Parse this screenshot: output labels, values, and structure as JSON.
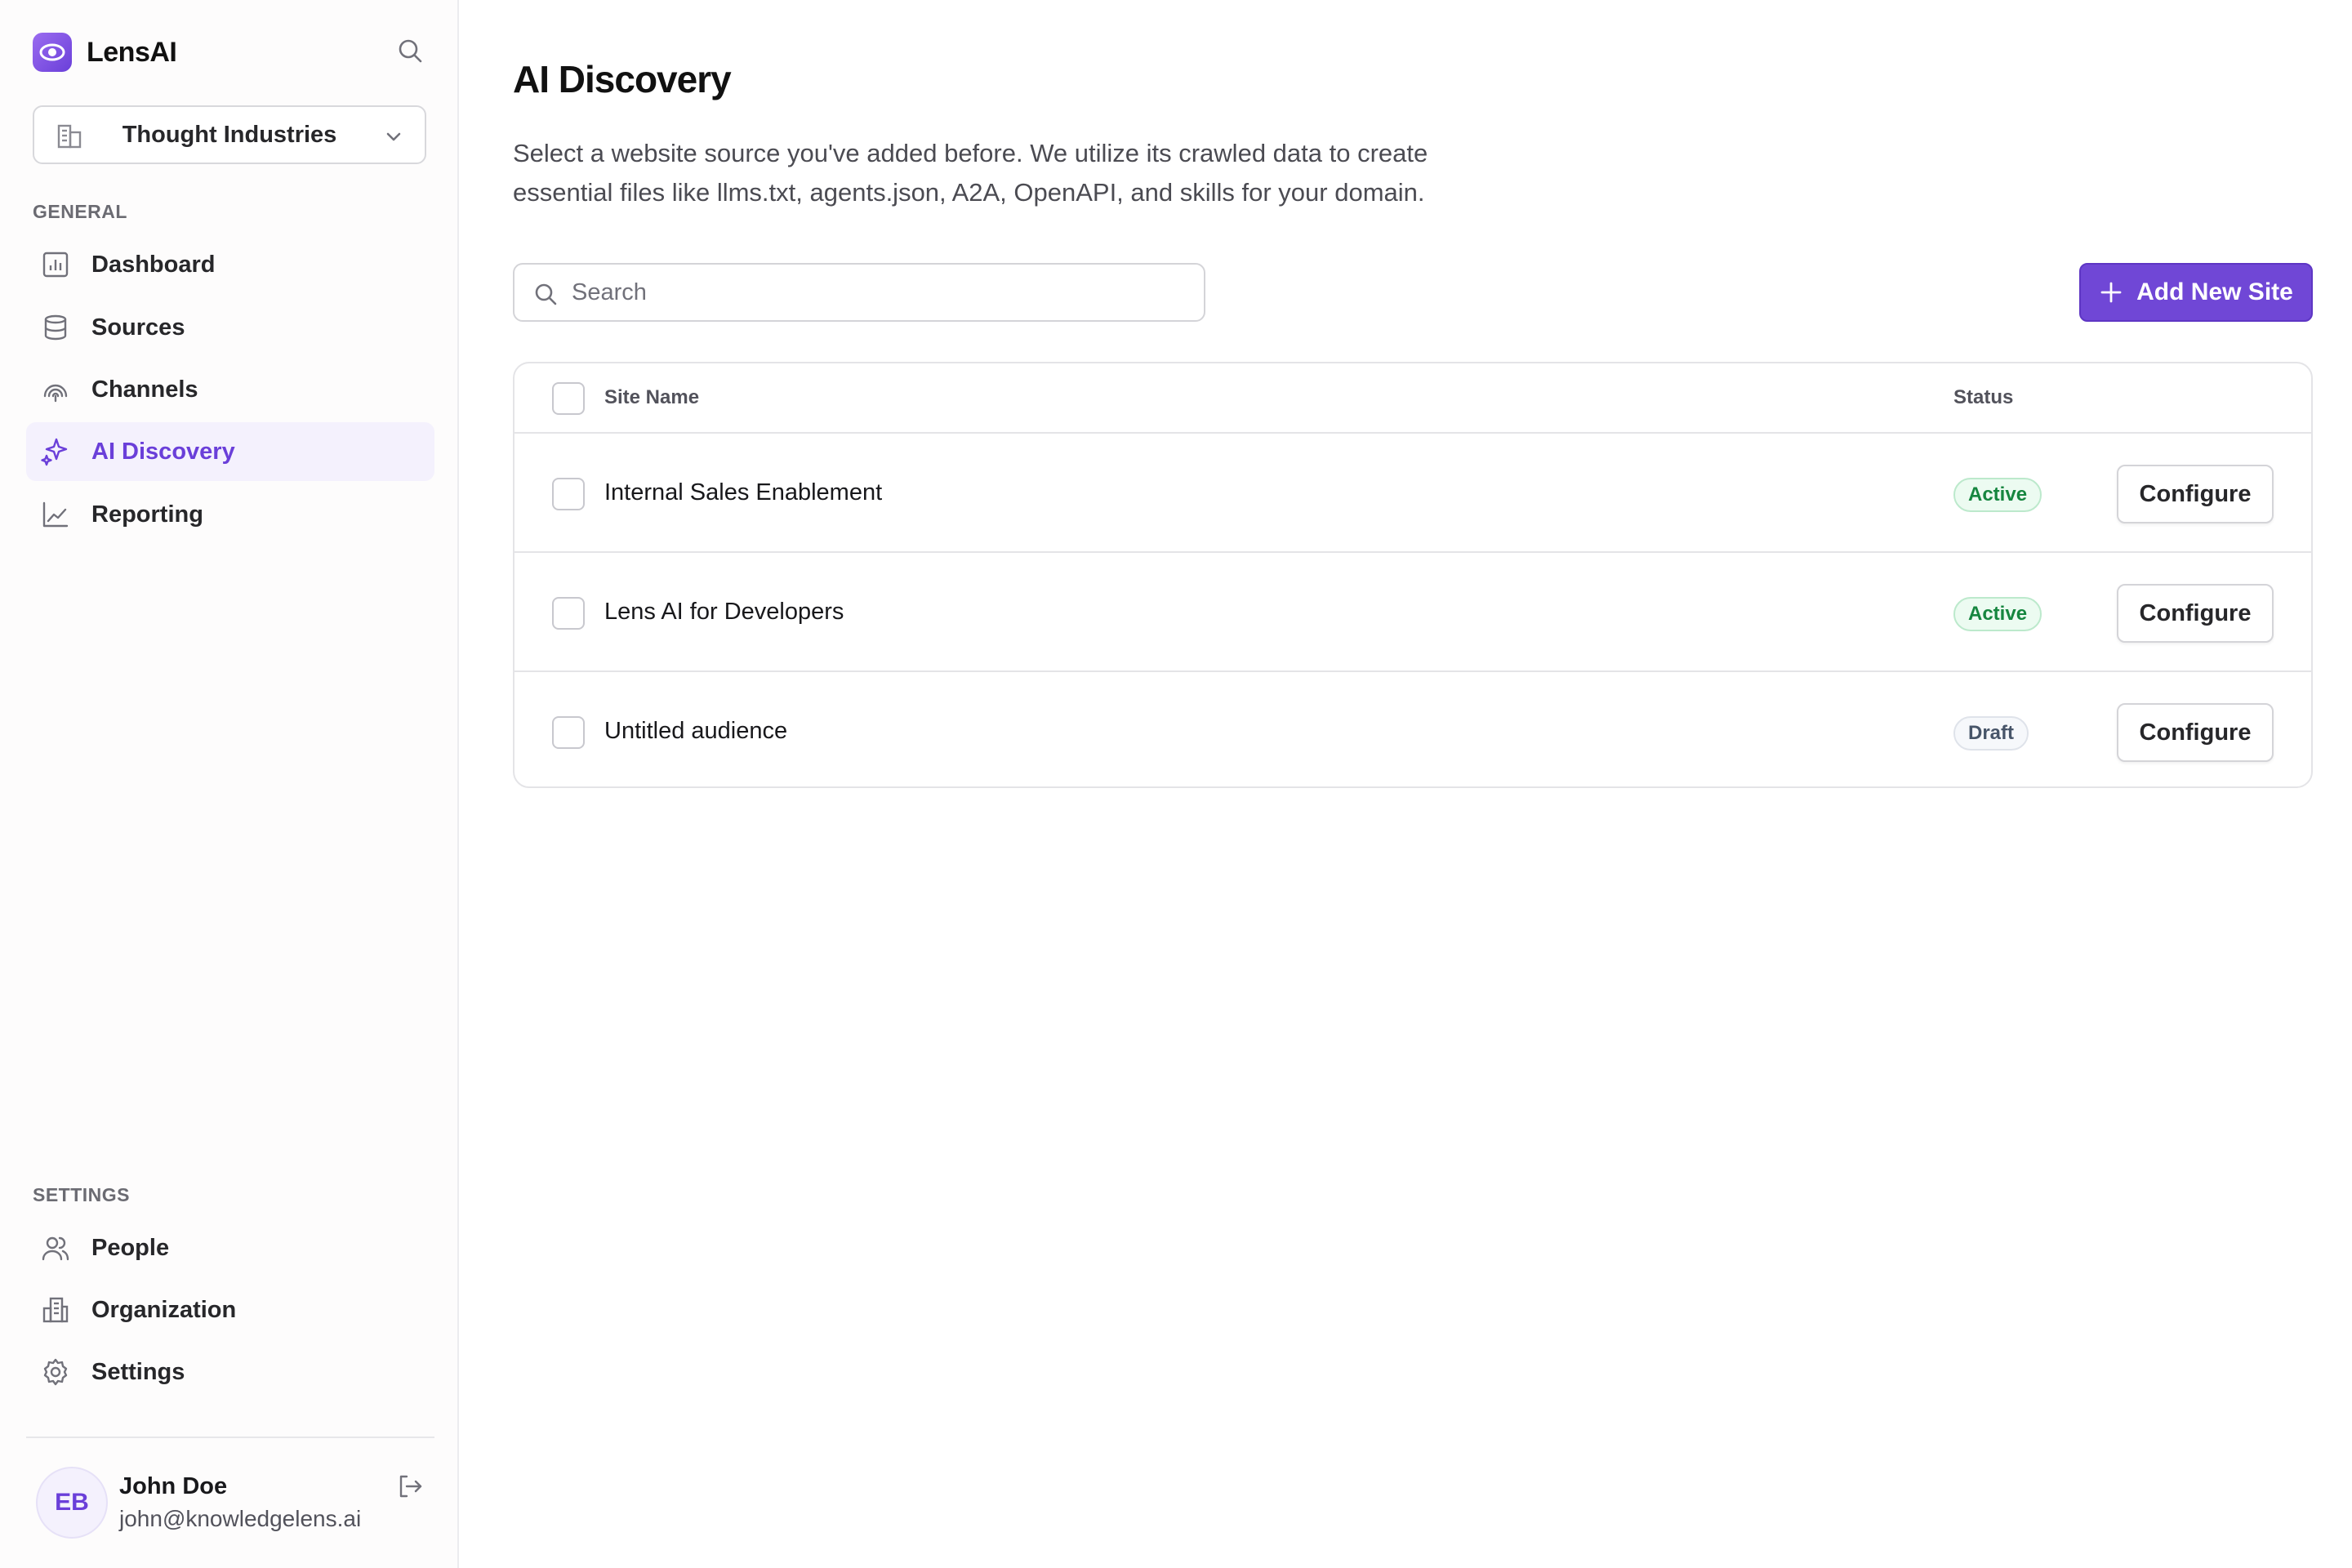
{
  "app": {
    "name": "LensAI",
    "accent": "#7047d6"
  },
  "sidebar": {
    "org_selector": {
      "value": "Thought Industries"
    },
    "general_label": "GENERAL",
    "general_items": [
      {
        "label": "Dashboard",
        "icon": "dashboard-icon"
      },
      {
        "label": "Sources",
        "icon": "database-icon"
      },
      {
        "label": "Channels",
        "icon": "channels-icon"
      },
      {
        "label": "AI Discovery",
        "icon": "sparkles-icon",
        "active": true
      },
      {
        "label": "Reporting",
        "icon": "line-chart-icon"
      }
    ],
    "settings_label": "SETTINGS",
    "settings_items": [
      {
        "label": "People",
        "icon": "people-icon"
      },
      {
        "label": "Organization",
        "icon": "building-icon"
      },
      {
        "label": "Settings",
        "icon": "gear-icon"
      }
    ],
    "user": {
      "initials": "EB",
      "name": "John Doe",
      "email": "john@knowledgelens.ai"
    }
  },
  "main": {
    "title": "AI Discovery",
    "description": "Select a website source you've added before. We utilize its crawled data to create essential files like llms.txt, agents.json, A2A, OpenAPI, and skills for your domain.",
    "search": {
      "placeholder": "Search",
      "value": ""
    },
    "add_button_label": "Add New Site",
    "table": {
      "columns": [
        "Site Name",
        "Status"
      ],
      "rows": [
        {
          "name": "Internal Sales Enablement",
          "status": "Active",
          "action": "Configure"
        },
        {
          "name": "Lens AI for Developers",
          "status": "Active",
          "action": "Configure"
        },
        {
          "name": "Untitled audience",
          "status": "Draft",
          "action": "Configure"
        }
      ]
    }
  }
}
